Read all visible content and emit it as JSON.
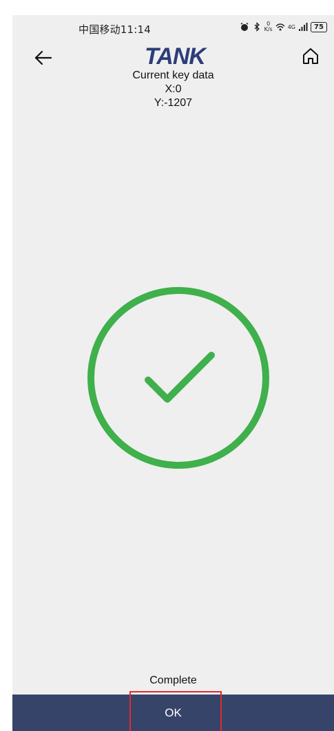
{
  "status_bar": {
    "carrier_time": "中国移动11:14",
    "speed_top": "0",
    "speed_bottom": "K/s",
    "network": "4G",
    "battery": "75"
  },
  "header": {
    "back_icon": "arrow-left-icon",
    "logo_text": "TANK",
    "home_icon": "home-icon",
    "logo_color": "#2c3d78"
  },
  "key_data": {
    "title": "Current key data",
    "x": "X:0",
    "y": "Y:-1207"
  },
  "result": {
    "icon": "check-circle-icon",
    "color": "#3fb04b",
    "label": "Complete"
  },
  "footer": {
    "ok_label": "OK",
    "bar_color": "#374469",
    "highlight_color": "#e3282e"
  }
}
